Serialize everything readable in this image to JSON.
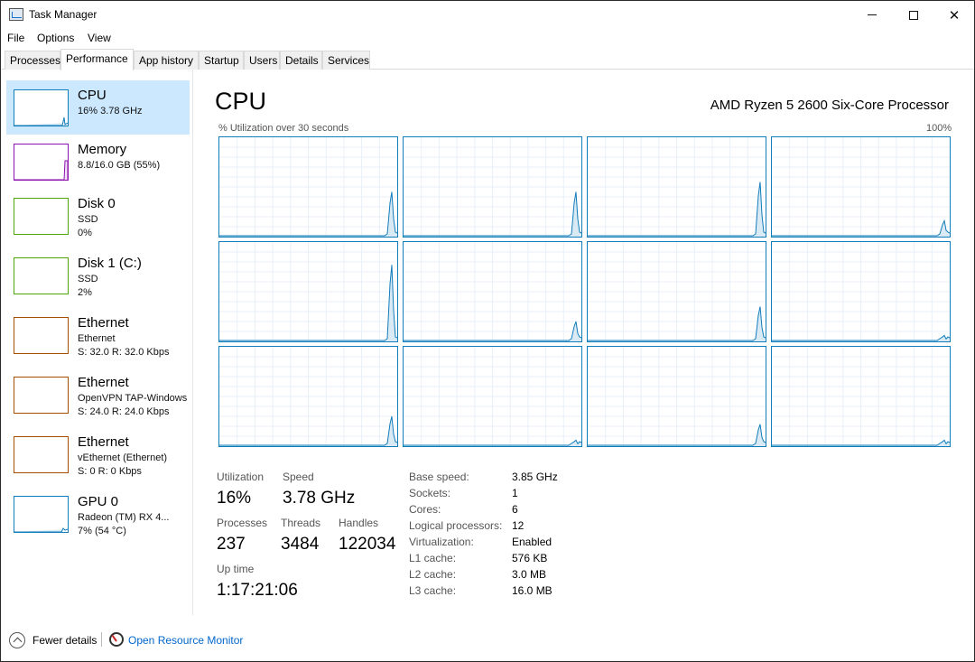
{
  "window": {
    "title": "Task Manager"
  },
  "menu": [
    "File",
    "Options",
    "View"
  ],
  "tabs": [
    "Processes",
    "Performance",
    "App history",
    "Startup",
    "Users",
    "Details",
    "Services"
  ],
  "sidebar": {
    "items": [
      {
        "title": "CPU",
        "sub1": "16%  3.78 GHz",
        "sub2": "",
        "color": "#117dbb"
      },
      {
        "title": "Memory",
        "sub1": "8.8/16.0 GB (55%)",
        "sub2": "",
        "color": "#8b12ae"
      },
      {
        "title": "Disk 0",
        "sub1": "SSD",
        "sub2": "0%",
        "color": "#4da60c"
      },
      {
        "title": "Disk 1 (C:)",
        "sub1": "SSD",
        "sub2": "2%",
        "color": "#4da60c"
      },
      {
        "title": "Ethernet",
        "sub1": "Ethernet",
        "sub2": "S: 32.0  R: 32.0 Kbps",
        "color": "#a74f01"
      },
      {
        "title": "Ethernet",
        "sub1": "OpenVPN TAP-Windows",
        "sub2": "S: 24.0  R: 24.0 Kbps",
        "color": "#a74f01"
      },
      {
        "title": "Ethernet",
        "sub1": "vEthernet (Ethernet)",
        "sub2": "S: 0  R: 0 Kbps",
        "color": "#a74f01"
      },
      {
        "title": "GPU 0",
        "sub1": "Radeon (TM) RX 4...",
        "sub2": "7% (54 °C)",
        "color": "#117dbb"
      }
    ]
  },
  "main": {
    "title": "CPU",
    "processor": "AMD Ryzen 5 2600 Six-Core Processor",
    "util_label": "% Utilization over 30 seconds",
    "max_label": "100%",
    "core_peaks": [
      0.45,
      0.45,
      0.55,
      0.16,
      0.77,
      0.2,
      0.35,
      0.06,
      0.3,
      0.06,
      0.22,
      0.06
    ],
    "stats": {
      "utilization_label": "Utilization",
      "utilization": "16%",
      "speed_label": "Speed",
      "speed": "3.78 GHz",
      "processes_label": "Processes",
      "processes": "237",
      "threads_label": "Threads",
      "threads": "3484",
      "handles_label": "Handles",
      "handles": "122034",
      "uptime_label": "Up time",
      "uptime": "1:17:21:06"
    },
    "details": [
      {
        "label": "Base speed:",
        "value": "3.85 GHz"
      },
      {
        "label": "Sockets:",
        "value": "1"
      },
      {
        "label": "Cores:",
        "value": "6"
      },
      {
        "label": "Logical processors:",
        "value": "12"
      },
      {
        "label": "Virtualization:",
        "value": "Enabled"
      },
      {
        "label": "L1 cache:",
        "value": "576 KB"
      },
      {
        "label": "L2 cache:",
        "value": "3.0 MB"
      },
      {
        "label": "L3 cache:",
        "value": "16.0 MB"
      }
    ]
  },
  "footer": {
    "fewer_details": "Fewer details",
    "resource_monitor": "Open Resource Monitor"
  },
  "colors": {
    "accent": "#117dbb",
    "selected": "#cce8ff",
    "link": "#0066cc"
  }
}
